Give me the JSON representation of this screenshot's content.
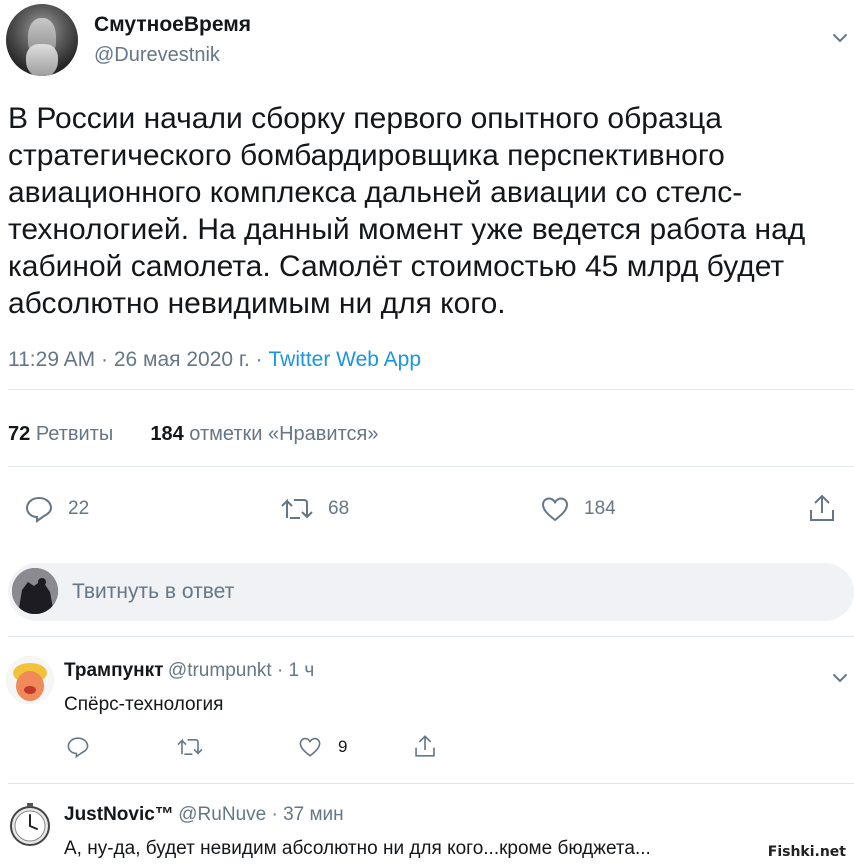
{
  "tweet": {
    "author_name": "СмутноеВремя",
    "author_handle": "@Durevestnik",
    "text": "В России начали сборку первого опытного образца\nстратегического бомбардировщика перспективного\nавиационного комплекса дальней авиации со стелс-\nтехнологией. На данный момент уже ведется работа над\nкабиной самолета. Самолёт стоимостью 45 млрд будет\nабсолютно невидимым ни для кого.",
    "time": "11:29 AM · 26 мая 2020 г. · ",
    "source": "Twitter Web App",
    "retweets_count": "72",
    "retweets_label": "Ретвиты",
    "likes_count": "184",
    "likes_label": "отметки «Нравится»",
    "actions": {
      "reply_count": "22",
      "retweet_count": "68",
      "like_count": "184"
    }
  },
  "reply_box": {
    "placeholder": "Твитнуть в ответ"
  },
  "comments": [
    {
      "name": "Трампункт",
      "handle": "@trumpunkt · 1 ч",
      "text": "Спёрс-технология",
      "reply_count": "",
      "retweet_count": "",
      "like_count": "9"
    },
    {
      "name": "JustNovic™",
      "handle": "@RuNuve · 37 мин",
      "text": "А, ну-да, будет невидим абсолютно ни для кого...кроме бюджета..."
    }
  ],
  "watermark": "Fishki.net",
  "colors": {
    "text": "#14171a",
    "secondary": "#657786",
    "link": "#1b95e0",
    "divider": "#e1e8ed"
  }
}
